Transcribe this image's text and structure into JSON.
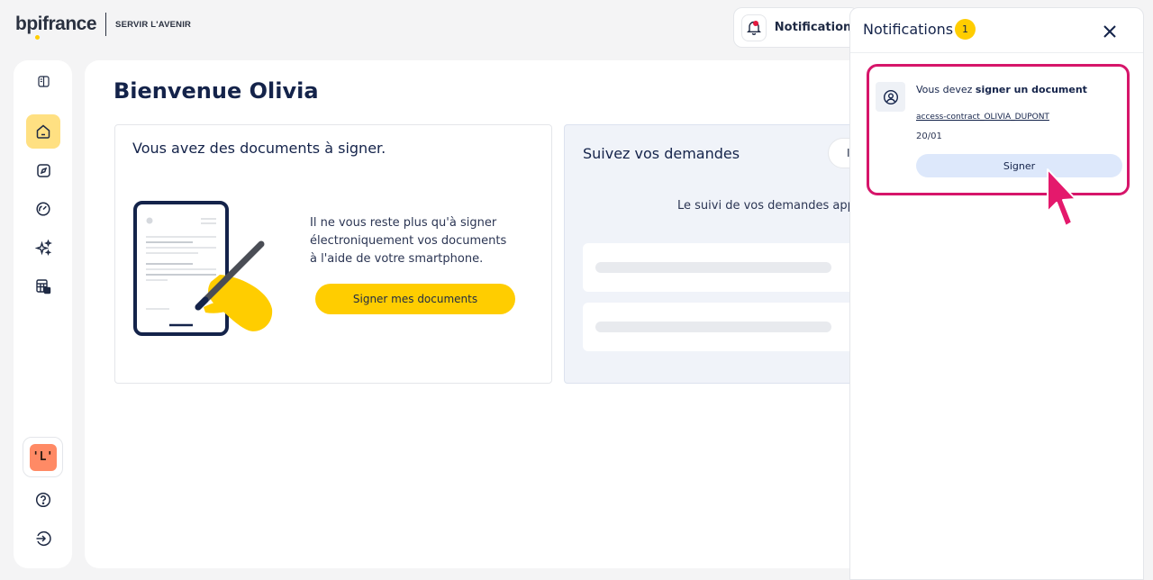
{
  "header": {
    "brand": "bpifrance",
    "tagline": "SERVIR L'AVENIR",
    "notifications_label": "Notifications"
  },
  "sidebar": {
    "items": [
      {
        "name": "collapse",
        "icon": "sidebar-toggle-icon"
      },
      {
        "name": "home",
        "icon": "home-icon",
        "active": true
      },
      {
        "name": "explore",
        "icon": "compass-icon"
      },
      {
        "name": "dashboard",
        "icon": "gauge-icon"
      },
      {
        "name": "services",
        "icon": "sparkles-icon"
      },
      {
        "name": "documents",
        "icon": "spreadsheet-icon"
      }
    ],
    "avatar_glyph": "'L'",
    "footer": [
      {
        "name": "help",
        "icon": "question-icon"
      },
      {
        "name": "logout",
        "icon": "logout-icon"
      }
    ]
  },
  "main": {
    "welcome": "Bienvenue Olivia",
    "sign_card": {
      "title": "Vous avez des documents à signer.",
      "text": "Il ne vous reste plus qu'à signer électroniquement vos documents à l'aide de votre smartphone.",
      "cta": "Signer mes documents"
    },
    "follow_card": {
      "title": "Suivez vos demandes",
      "pill": "I",
      "text": "Le suivi de vos demandes appara"
    }
  },
  "panel": {
    "title": "Notifications",
    "badge": "1",
    "item": {
      "message_prefix": "Vous devez ",
      "message_bold": "signer un document",
      "link": "access-contract_OLIVIA_DUPONT",
      "date": "20/01",
      "button": "Signer"
    }
  },
  "colors": {
    "accent": "#ffcd00",
    "highlight": "#d6156a",
    "navy": "#14234a",
    "button_light": "#dde8fb"
  }
}
